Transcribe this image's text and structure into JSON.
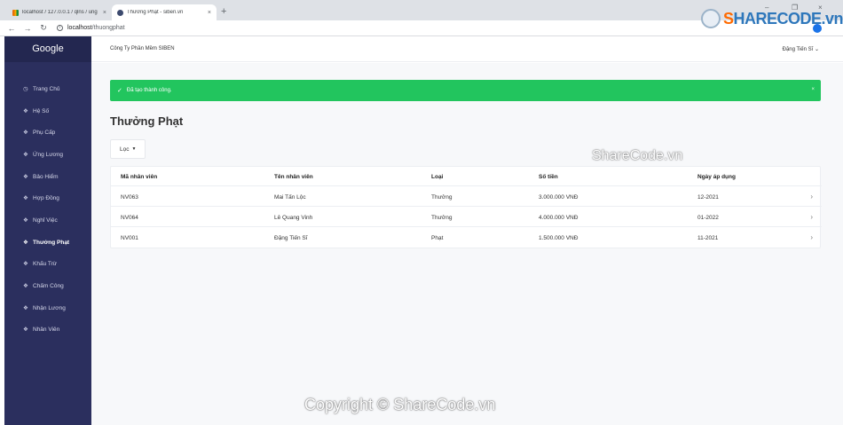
{
  "browser": {
    "tabs": [
      {
        "title": "localhost / 127.0.0.1 / qlns / ung"
      },
      {
        "title": "Thưởng Phạt - siben.vn"
      }
    ],
    "new_tab": "+",
    "close_glyph": "×",
    "controls": {
      "minimize": "–",
      "maximize": "❐",
      "close": "×"
    },
    "address": {
      "host": "localhost",
      "path": "/thuongphat"
    }
  },
  "sidebar": {
    "brand": "Google",
    "items": [
      {
        "label": "Trang Chủ",
        "icon": "clock-icon"
      },
      {
        "label": "Hệ Số",
        "icon": "users-icon"
      },
      {
        "label": "Phụ Cấp",
        "icon": "users-icon"
      },
      {
        "label": "Ứng Lương",
        "icon": "users-icon"
      },
      {
        "label": "Bảo Hiểm",
        "icon": "users-icon"
      },
      {
        "label": "Hợp Đồng",
        "icon": "users-icon"
      },
      {
        "label": "Nghỉ Việc",
        "icon": "users-icon"
      },
      {
        "label": "Thưởng Phạt",
        "icon": "users-icon",
        "active": true
      },
      {
        "label": "Khấu Trừ",
        "icon": "users-icon"
      },
      {
        "label": "Chấm Công",
        "icon": "users-icon"
      },
      {
        "label": "Nhận Lương",
        "icon": "users-icon"
      },
      {
        "label": "Nhân Viên",
        "icon": "users-icon"
      }
    ]
  },
  "header": {
    "company": "Công Ty Phần Mềm SIBEN",
    "user": "Đặng Tiến Sĩ",
    "user_caret": "⌄"
  },
  "alert": {
    "message": "Đã tạo thành công.",
    "close": "×",
    "color": "#22c55e"
  },
  "page": {
    "title": "Thưởng Phạt",
    "filter_label": "Lọc"
  },
  "table": {
    "columns": [
      "Mã nhân viên",
      "Tên nhân viên",
      "Loại",
      "Số tiền",
      "Ngày áp dụng"
    ],
    "rows": [
      {
        "id": "NV063",
        "name": "Mai Tấn Lộc",
        "type": "Thưởng",
        "amount": "3.000.000 VNĐ",
        "date": "12-2021"
      },
      {
        "id": "NV064",
        "name": "Lê Quang Vinh",
        "type": "Thưởng",
        "amount": "4.000.000 VNĐ",
        "date": "01-2022"
      },
      {
        "id": "NV001",
        "name": "Đặng Tiến Sĩ",
        "type": "Phạt",
        "amount": "1.500.000 VNĐ",
        "date": "11-2021"
      }
    ]
  },
  "watermarks": {
    "logo_s": "S",
    "logo_rest": "HARECODE.vn",
    "middle": "ShareCode.vn",
    "bottom": "Copyright © ShareCode.vn"
  }
}
